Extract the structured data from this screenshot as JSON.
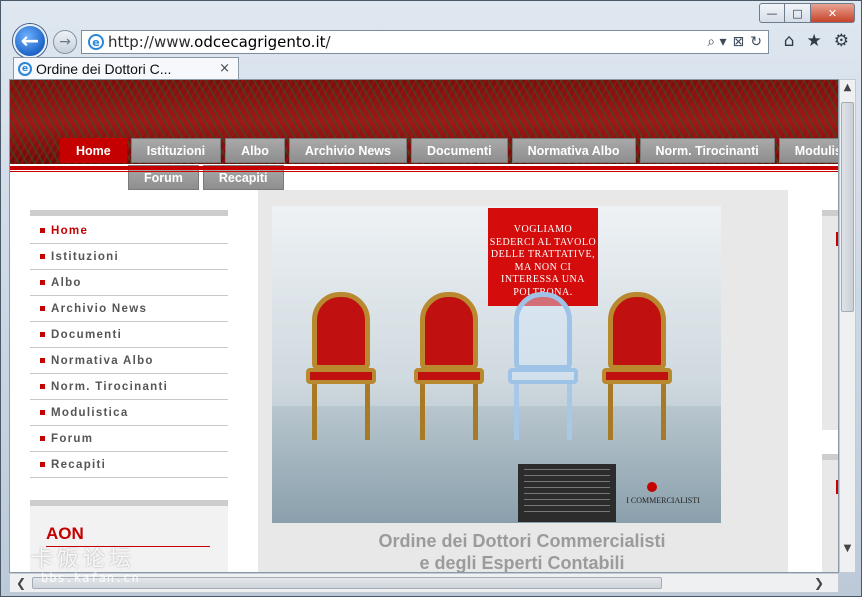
{
  "browser": {
    "url_prefix": "http://www.",
    "url_host": "odcecagrigento.it",
    "url_suffix": "/",
    "tab_title": "Ordine dei Dottori C...",
    "tab_close": "×",
    "back_glyph": "←",
    "forward_glyph": "→",
    "ie_glyph": "e",
    "win_min": "—",
    "win_max": "□",
    "win_close": "✕",
    "addr_tools": [
      "⌕ ▾",
      "⊠",
      "↻"
    ],
    "right_tools": [
      "⌂",
      "★",
      "⚙"
    ],
    "scroll_up": "▲",
    "scroll_down": "▼",
    "scroll_left": "❮",
    "scroll_right": "❯"
  },
  "menu": {
    "row1": [
      "Home",
      "Istituzioni",
      "Albo",
      "Archivio News",
      "Documenti",
      "Normativa Albo",
      "Norm. Tirocinanti",
      "Modulistica"
    ],
    "row2": [
      "Forum",
      "Recapiti"
    ],
    "active_index": 0
  },
  "sidebar": {
    "items": [
      "Home",
      "Istituzioni",
      "Albo",
      "Archivio News",
      "Documenti",
      "Normativa Albo",
      "Norm. Tirocinanti",
      "Modulistica",
      "Forum",
      "Recapiti"
    ],
    "active_index": 0
  },
  "aon": {
    "title": "AON"
  },
  "poster": {
    "slogan_lines": [
      "VOGLIAMO",
      "SEDERCI AL TAVOLO",
      "DELLE TRATTATIVE,",
      "MA NON CI",
      "INTERESSA UNA",
      "POLTRONA."
    ],
    "logo_text": "I COMMERCIALISTI"
  },
  "caption": {
    "line1": "Ordine dei Dottori Commercialisti",
    "line2": "e degli Esperti Contabili"
  },
  "watermark": {
    "line1": "卡饭论坛",
    "line2": "bbs.kafan.cn"
  },
  "colors": {
    "accent_red": "#c40000",
    "menu_gray": "#9a9a9a",
    "ie_blue": "#1d64c6"
  }
}
